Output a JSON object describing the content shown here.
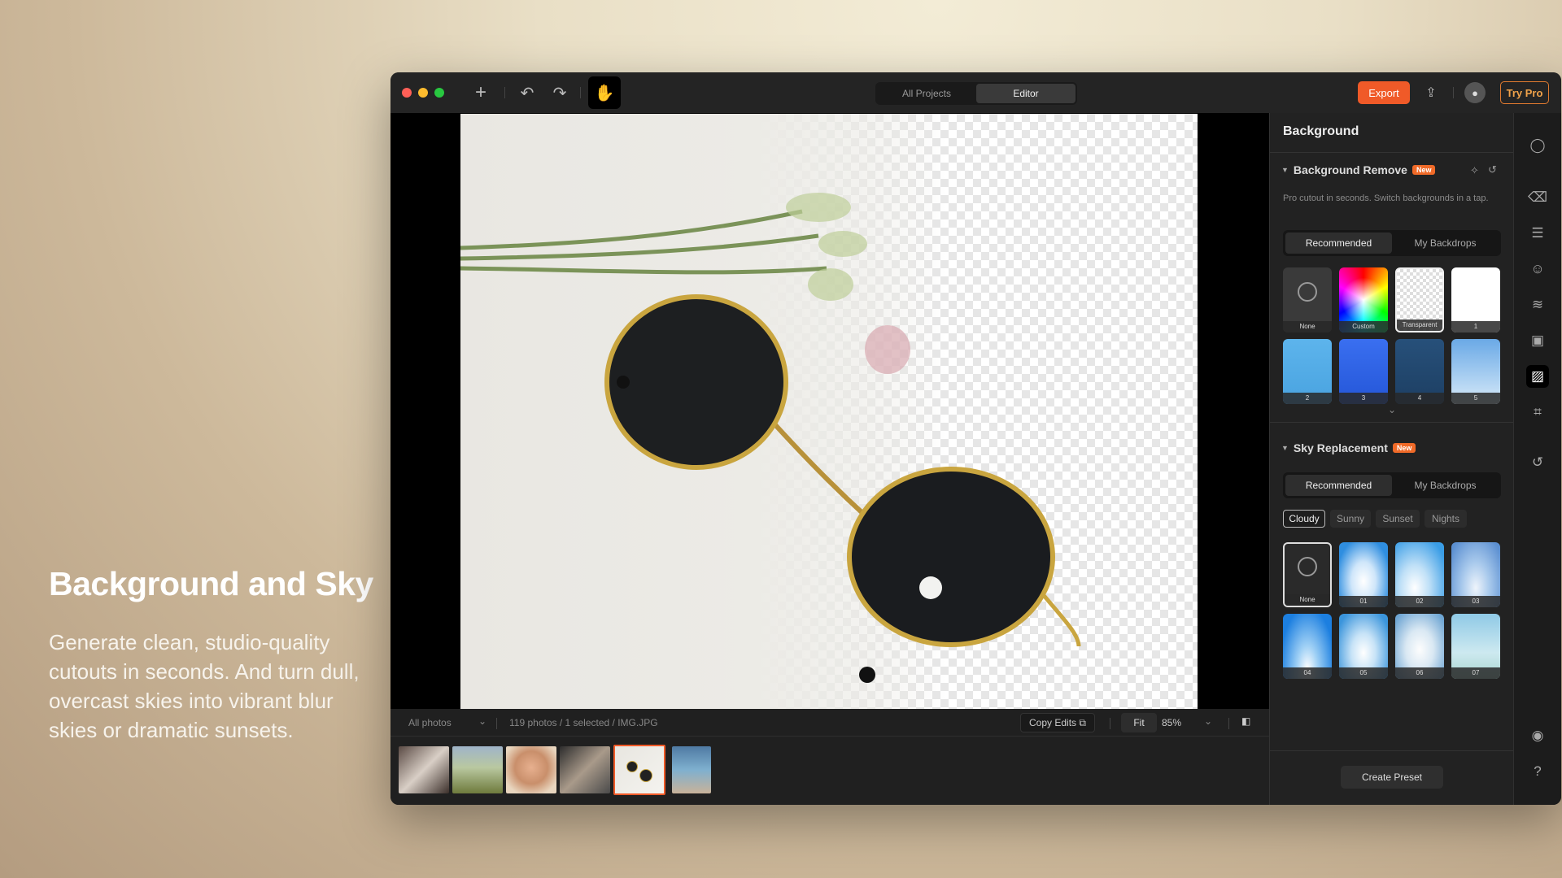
{
  "hero": {
    "title": "Background and Sky",
    "body": "Generate clean, studio-quality cutouts in seconds. And turn dull, overcast skies into vibrant blur skies or dramatic sunsets."
  },
  "toolbar": {
    "tabs": [
      "All Projects",
      "Editor"
    ],
    "active_tab": "Editor",
    "export_label": "Export",
    "try_pro_label": "Try Pro"
  },
  "bottom": {
    "album": "All photos",
    "status": "119 photos / 1 selected / IMG.JPG",
    "copy_edits": "Copy Edits",
    "fit": "Fit",
    "zoom": "85%"
  },
  "panel": {
    "title": "Background",
    "bg_remove": {
      "title": "Background Remove",
      "badge": "New",
      "desc": "Pro cutout in seconds. Switch backgrounds in a tap.",
      "tabs": [
        "Recommended",
        "My Backdrops"
      ],
      "swatches": [
        "None",
        "Custom",
        "Transparent",
        "1",
        "2",
        "3",
        "4",
        "5"
      ],
      "selected": "Transparent"
    },
    "sky": {
      "title": "Sky Replacement",
      "badge": "New",
      "tabs": [
        "Recommended",
        "My Backdrops"
      ],
      "chips": [
        "Cloudy",
        "Sunny",
        "Sunset",
        "Nights"
      ],
      "active_chip": "Cloudy",
      "swatches": [
        "None",
        "01",
        "02",
        "03",
        "04",
        "05",
        "06",
        "07"
      ],
      "selected": "None"
    },
    "create_preset": "Create Preset"
  },
  "colors": {
    "accent": "#f05a28",
    "panel": "#222222"
  }
}
